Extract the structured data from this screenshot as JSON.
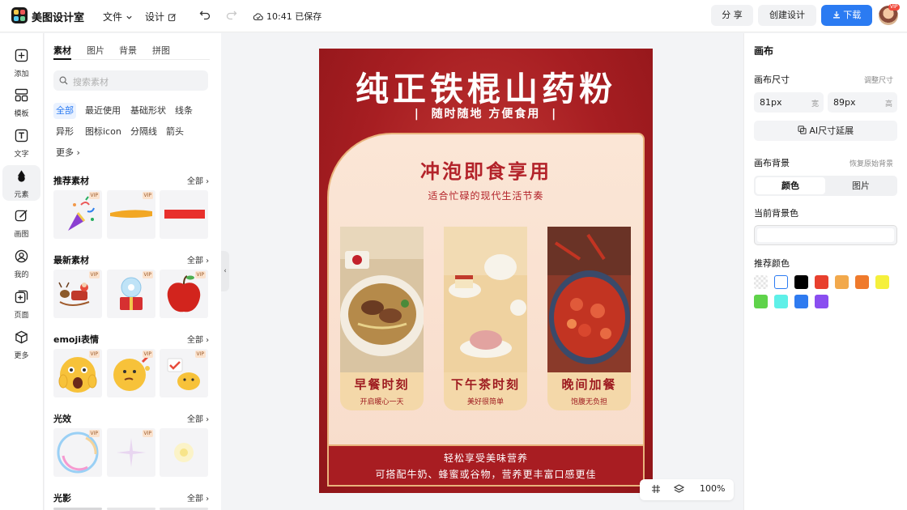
{
  "app": {
    "title": "美图设计室"
  },
  "menu": {
    "file": "文件",
    "design": "设计"
  },
  "save_status": "10:41 已保存",
  "actions": {
    "share": "分 享",
    "create": "创建设计",
    "download": "下载"
  },
  "avatar_badge": "VIP",
  "rail": [
    {
      "label": "添加",
      "icon": "plus-square-icon"
    },
    {
      "label": "模板",
      "icon": "template-icon"
    },
    {
      "label": "文字",
      "icon": "text-icon"
    },
    {
      "label": "元素",
      "icon": "shapes-icon"
    },
    {
      "label": "画图",
      "icon": "draw-icon"
    },
    {
      "label": "我的",
      "icon": "user-icon"
    },
    {
      "label": "页面",
      "icon": "page-add-icon"
    },
    {
      "label": "更多",
      "icon": "cube-icon"
    }
  ],
  "left_panel": {
    "tabs": [
      "素材",
      "图片",
      "背景",
      "拼图"
    ],
    "search_placeholder": "搜索素材",
    "chips": [
      "全部",
      "最近使用",
      "基础形状",
      "线条",
      "异形",
      "图标icon",
      "分隔线",
      "箭头",
      "更多"
    ],
    "sections": [
      {
        "title": "推荐素材",
        "all": "全部"
      },
      {
        "title": "最新素材",
        "all": "全部"
      },
      {
        "title": "emoji表情",
        "all": "全部"
      },
      {
        "title": "光效",
        "all": "全部"
      },
      {
        "title": "光影",
        "all": "全部"
      }
    ],
    "vip_label": "VIP"
  },
  "poster": {
    "title": "纯正铁棍山药粉",
    "subtitle": "随时随地 方便食用",
    "heading": "冲泡即食享用",
    "heading_sub": "适合忙碌的现代生活节奏",
    "foods": [
      {
        "name": "早餐时刻",
        "desc": "开启暖心一天"
      },
      {
        "name": "下午茶时刻",
        "desc": "美好很简单"
      },
      {
        "name": "晚间加餐",
        "desc": "饱腹无负担"
      }
    ],
    "footer_line1": "轻松享受美味营养",
    "footer_line2": "可搭配牛奶、蜂蜜或谷物，营养更丰富口感更佳"
  },
  "zoom": "100%",
  "right_panel": {
    "title": "画布",
    "size_label": "画布尺寸",
    "size_link": "调整尺寸",
    "width_value": "81px",
    "width_unit": "宽",
    "height_value": "89px",
    "height_unit": "高",
    "ai_extend": "AI尺寸延展",
    "bg_label": "画布背景",
    "bg_reset": "恢复原始背景",
    "seg_color": "颜色",
    "seg_image": "图片",
    "current_bg": "当前背景色",
    "recommended": "推荐颜色",
    "swatches": [
      "transparent",
      "#ffffff",
      "#000000",
      "#e8402e",
      "#f2a94c",
      "#ef7a2c",
      "#f5f03c",
      "#5fd34a",
      "#5ef0e8",
      "#2f7bf0",
      "#8a4ef0"
    ]
  },
  "colors": {
    "accent": "#2b7bf2",
    "poster_red": "#a71e22",
    "poster_cream": "#fbe6d6"
  }
}
